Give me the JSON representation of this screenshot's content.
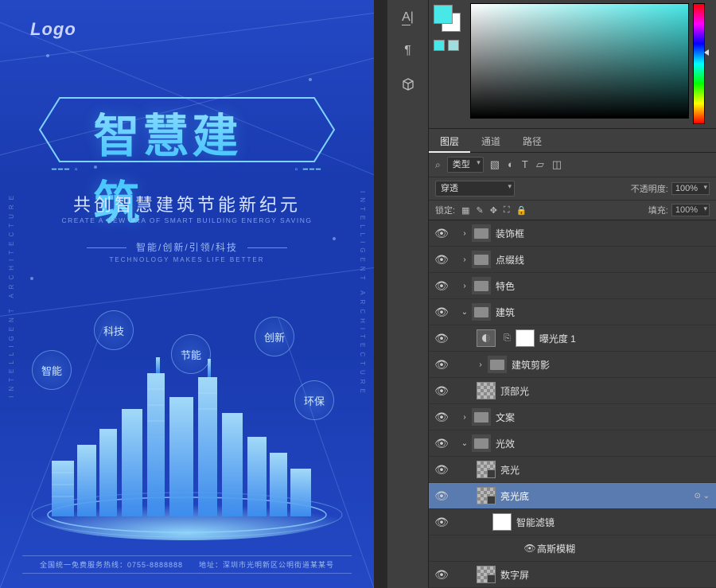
{
  "poster": {
    "logo": "Logo",
    "main_title": "智慧建筑",
    "subtitle": "共创智慧建筑节能新纪元",
    "subtitle_en": "CREATE A NEW ERA OF SMART BUILDING ENERGY SAVING",
    "slogan": "智能/创新/引领/科技",
    "slogan_en": "TECHNOLOGY MAKES LIFE BETTER",
    "side_text_left": "INTELLIGENT ARCHITECTURE",
    "side_text_right": "INTELLIGENT ARCHITECTURE",
    "bubbles": [
      "科技",
      "智能",
      "节能",
      "创新",
      "环保"
    ],
    "title_mark_left": "━━━ ▫",
    "title_mark_right": "▫ ━━━",
    "footer": "全国统一免费服务热线：0755-8888888　　地址：深圳市光明新区公明街道某某号"
  },
  "color_panel": {
    "foreground": "#48e8e8",
    "background": "#ffffff",
    "tiny1": "#48e8e8",
    "tiny2": "#a0dede"
  },
  "layers_panel": {
    "tabs": [
      "图层",
      "通道",
      "路径"
    ],
    "filter_label": "类型",
    "blend_mode": "穿透",
    "opacity_label": "不透明度:",
    "opacity_value": "100%",
    "lock_label": "锁定:",
    "fill_label": "填充:",
    "fill_value": "100%",
    "layers": [
      {
        "vis": true,
        "depth": 0,
        "kind": "folder",
        "twisty": "›",
        "name": "装饰框"
      },
      {
        "vis": true,
        "depth": 0,
        "kind": "folder",
        "twisty": "›",
        "name": "点缀线"
      },
      {
        "vis": true,
        "depth": 0,
        "kind": "folder",
        "twisty": "›",
        "name": "特色"
      },
      {
        "vis": true,
        "depth": 0,
        "kind": "folder",
        "twisty": "⌄",
        "name": "建筑"
      },
      {
        "vis": true,
        "depth": 1,
        "kind": "adj-mask",
        "name": "曝光度 1"
      },
      {
        "vis": true,
        "depth": 1,
        "kind": "folder",
        "twisty": "›",
        "name": "建筑剪影"
      },
      {
        "vis": true,
        "depth": 1,
        "kind": "trans",
        "name": "顶部光"
      },
      {
        "vis": true,
        "depth": 0,
        "kind": "folder",
        "twisty": "›",
        "name": "文案"
      },
      {
        "vis": true,
        "depth": 0,
        "kind": "folder",
        "twisty": "⌄",
        "name": "光效"
      },
      {
        "vis": true,
        "depth": 1,
        "kind": "smart-trans",
        "name": "亮光"
      },
      {
        "vis": true,
        "depth": 1,
        "kind": "smart-trans",
        "name": "亮光底",
        "fx": true,
        "selected": true
      },
      {
        "vis": true,
        "depth": 2,
        "kind": "smart-filters-label",
        "name": "智能滤镜"
      },
      {
        "vis": true,
        "depth": 2,
        "kind": "filter-entry",
        "name": "高斯模糊"
      },
      {
        "vis": true,
        "depth": 1,
        "kind": "smart-trans",
        "name": "数字屏"
      }
    ]
  },
  "tool_strip": {
    "tools": [
      "type-mask-icon",
      "paragraph-icon",
      "3d-icon"
    ]
  }
}
